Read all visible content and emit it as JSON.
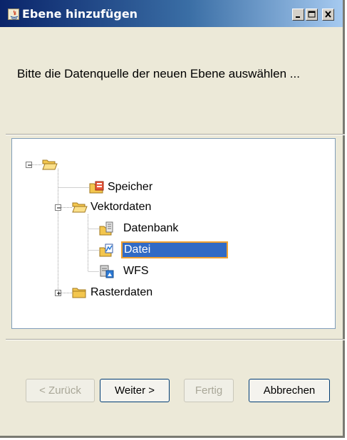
{
  "window": {
    "title": "Ebene hinzufügen",
    "controls": [
      "minimize",
      "maximize",
      "close"
    ]
  },
  "instruction": "Bitte die Datenquelle der neuen Ebene auswählen ...",
  "tree": {
    "root": {
      "label": "",
      "expanded": true
    },
    "nodes": [
      {
        "label": "Speicher",
        "icon": "memory-folder-icon"
      },
      {
        "label": "Vektordaten",
        "icon": "open-folder-icon",
        "expanded": true,
        "children": [
          {
            "label": "Datenbank",
            "icon": "database-icon"
          },
          {
            "label": "Datei",
            "icon": "file-icon",
            "selected": true
          },
          {
            "label": "WFS",
            "icon": "wfs-icon"
          }
        ]
      },
      {
        "label": "Rasterdaten",
        "icon": "closed-folder-icon",
        "expanded": false
      }
    ]
  },
  "buttons": {
    "back": {
      "label": "< Zurück",
      "enabled": false
    },
    "next": {
      "label": "Weiter >",
      "enabled": true
    },
    "finish": {
      "label": "Fertig",
      "enabled": false
    },
    "cancel": {
      "label": "Abbrechen",
      "enabled": true
    }
  },
  "colors": {
    "titlebar_start": "#0A246A",
    "titlebar_end": "#A6CAF0",
    "selection": "#316AC5",
    "selection_outline": "#F0A030",
    "dialog_bg": "#ECE9D8"
  }
}
